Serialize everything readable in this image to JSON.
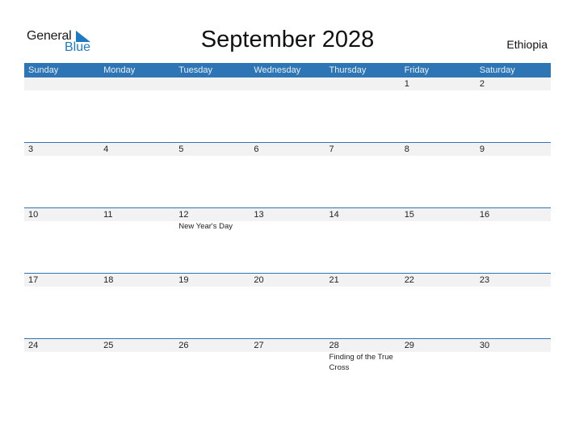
{
  "logo": {
    "general": "General",
    "blue": "Blue"
  },
  "title": "September 2028",
  "country": "Ethiopia",
  "colors": {
    "accent": "#2e75b6",
    "row_band": "#f2f2f2"
  },
  "weekdays": [
    "Sunday",
    "Monday",
    "Tuesday",
    "Wednesday",
    "Thursday",
    "Friday",
    "Saturday"
  ],
  "weeks": [
    [
      {
        "d": ""
      },
      {
        "d": ""
      },
      {
        "d": ""
      },
      {
        "d": ""
      },
      {
        "d": ""
      },
      {
        "d": "1"
      },
      {
        "d": "2"
      }
    ],
    [
      {
        "d": "3"
      },
      {
        "d": "4"
      },
      {
        "d": "5"
      },
      {
        "d": "6"
      },
      {
        "d": "7"
      },
      {
        "d": "8"
      },
      {
        "d": "9"
      }
    ],
    [
      {
        "d": "10"
      },
      {
        "d": "11"
      },
      {
        "d": "12",
        "e": "New Year's Day"
      },
      {
        "d": "13"
      },
      {
        "d": "14"
      },
      {
        "d": "15"
      },
      {
        "d": "16"
      }
    ],
    [
      {
        "d": "17"
      },
      {
        "d": "18"
      },
      {
        "d": "19"
      },
      {
        "d": "20"
      },
      {
        "d": "21"
      },
      {
        "d": "22"
      },
      {
        "d": "23"
      }
    ],
    [
      {
        "d": "24"
      },
      {
        "d": "25"
      },
      {
        "d": "26"
      },
      {
        "d": "27"
      },
      {
        "d": "28",
        "e": "Finding of the True Cross"
      },
      {
        "d": "29"
      },
      {
        "d": "30"
      }
    ]
  ]
}
